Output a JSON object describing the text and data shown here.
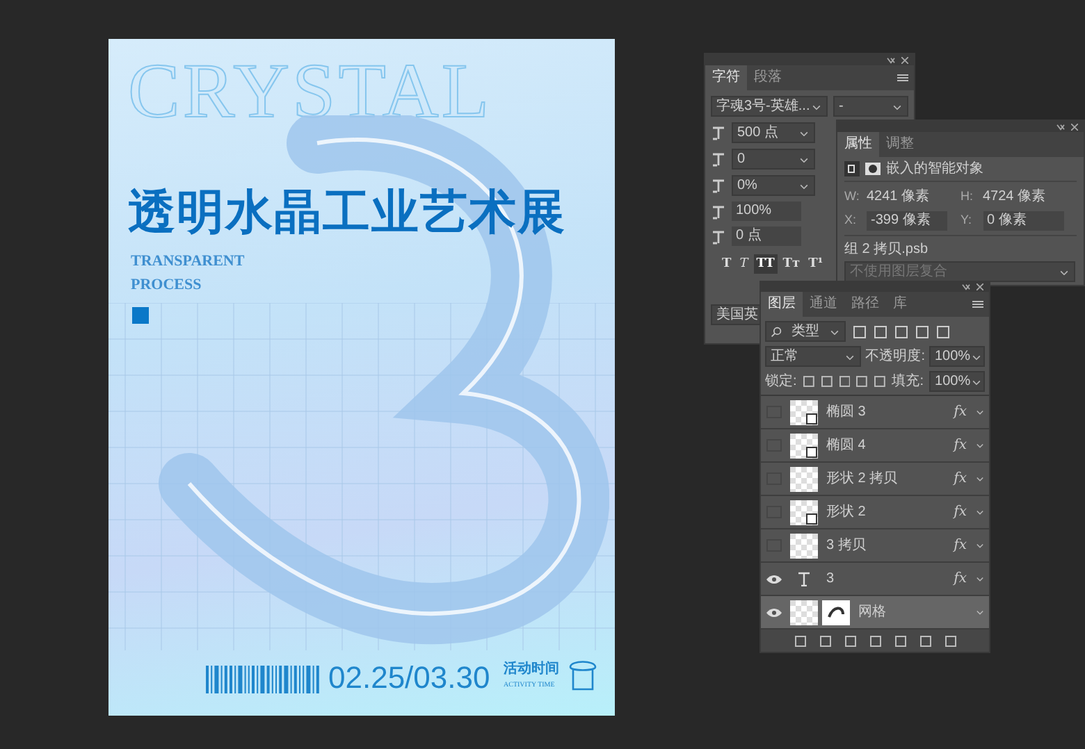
{
  "poster": {
    "outline_title": "CRYSTAL",
    "heading": "透明水晶工业艺术展",
    "subtitle_lines": [
      "TRANSPARENT",
      "PROCESS"
    ],
    "date": "02.25/03.30",
    "time_label": "活动时间",
    "time_label_en": "ACTIVITY TIME"
  },
  "character_panel": {
    "tabs": [
      {
        "label": "字符",
        "selected": true
      },
      {
        "label": "段落",
        "selected": false
      }
    ],
    "font_family": "字魂3号-英雄...",
    "font_style": "-",
    "size": "500 点",
    "kerning": "0",
    "tracking": "0%",
    "vertical_scale": "100%",
    "baseline_shift": "0 点",
    "style_buttons": [
      {
        "label": "T",
        "kind": "bold",
        "selected": false
      },
      {
        "label": "T",
        "kind": "italic",
        "selected": false
      },
      {
        "label": "TT",
        "kind": "caps",
        "selected": true
      },
      {
        "label": "Tт",
        "kind": "smallcaps",
        "selected": false
      },
      {
        "label": "T¹",
        "kind": "super",
        "selected": false
      }
    ],
    "language": "美国英"
  },
  "properties_panel": {
    "tabs": [
      {
        "label": "属性",
        "selected": true
      },
      {
        "label": "调整",
        "selected": false
      }
    ],
    "object_type": "嵌入的智能对象",
    "width_label": "W:",
    "width": "4241 像素",
    "height_label": "H:",
    "height": "4724 像素",
    "x_label": "X:",
    "x": "-399 像素",
    "y_label": "Y:",
    "y": "0 像素",
    "file_name": "组 2 拷贝.psb",
    "layer_comp": "不使用图层复合"
  },
  "layers_panel": {
    "tabs": [
      {
        "label": "图层",
        "selected": true
      },
      {
        "label": "通道",
        "selected": false
      },
      {
        "label": "路径",
        "selected": false
      },
      {
        "label": "库",
        "selected": false
      }
    ],
    "filter": "类型",
    "blend_mode": "正常",
    "opacity_label": "不透明度:",
    "opacity": "100%",
    "lock_label": "锁定:",
    "fill_label": "填充:",
    "fill": "100%",
    "layers": [
      {
        "name": "椭圆 3",
        "kind": "smart",
        "visible": false,
        "selected": false,
        "effects": "fx"
      },
      {
        "name": "椭圆 4",
        "kind": "smart",
        "visible": false,
        "selected": false,
        "effects": "fx"
      },
      {
        "name": "形状 2 拷贝",
        "kind": "pixel",
        "visible": false,
        "selected": false,
        "effects": "fx"
      },
      {
        "name": "形状 2",
        "kind": "smart",
        "visible": false,
        "selected": false,
        "effects": "fx"
      },
      {
        "name": "3 拷贝",
        "kind": "pixel",
        "visible": false,
        "selected": false,
        "effects": "fx"
      },
      {
        "name": "3",
        "kind": "text",
        "visible": true,
        "selected": false,
        "effects": "fx"
      },
      {
        "name": "网格",
        "kind": "masked",
        "visible": true,
        "selected": true
      }
    ]
  }
}
